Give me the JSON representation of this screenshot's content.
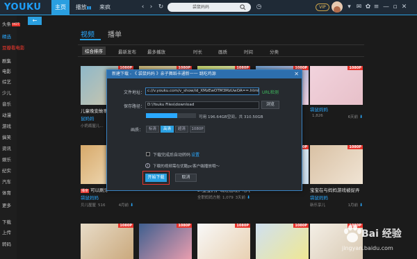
{
  "app": {
    "logo": "YOUKU"
  },
  "nav": [
    {
      "label": "主页",
      "active": true
    },
    {
      "label": "播放"
    },
    {
      "label": "来疯"
    }
  ],
  "search": {
    "value": "袋鼠妈妈"
  },
  "user": {
    "vip_label": "VIP"
  },
  "sidebar": {
    "items": [
      {
        "label": "头条",
        "badge": "HOT"
      },
      {
        "label": "精选",
        "style": "hl"
      },
      {
        "label": "豆瓣看电影",
        "style": "red"
      },
      {
        "label": "剧集"
      },
      {
        "label": "电影"
      },
      {
        "label": "综艺"
      },
      {
        "label": "少儿"
      },
      {
        "label": "音乐"
      },
      {
        "label": "动漫"
      },
      {
        "label": "游戏"
      },
      {
        "label": "搞笑"
      },
      {
        "label": "资讯"
      },
      {
        "label": "娱乐"
      },
      {
        "label": "纪实"
      },
      {
        "label": "汽车"
      },
      {
        "label": "体育"
      },
      {
        "label": "更多"
      },
      {
        "label": "下载"
      },
      {
        "label": "上传"
      },
      {
        "label": "转码"
      }
    ]
  },
  "main": {
    "tabs": [
      {
        "label": "视频",
        "active": true
      },
      {
        "label": "播单"
      }
    ],
    "filters": [
      {
        "label": "综合排序",
        "active": true
      },
      {
        "label": "最新发布"
      },
      {
        "label": "最多播放"
      },
      {
        "label": "时长"
      },
      {
        "label": "画质"
      },
      {
        "label": "时间"
      },
      {
        "label": "分类"
      }
    ]
  },
  "cards": [
    {
      "badge": "1080P",
      "title": "儿童晚安故事",
      "tag": "鼠妈妈",
      "author": "小奶瓶屋儿...",
      "plays": "",
      "date": ""
    },
    {
      "badge": "1080P",
      "title": "",
      "tag": "",
      "author": "",
      "plays": "",
      "date": ""
    },
    {
      "badge": "1080P",
      "title": "",
      "tag": "",
      "author": "",
      "plays": "",
      "date": ""
    },
    {
      "badge": "1080P",
      "title": "",
      "tag": "",
      "author": "",
      "plays": "",
      "date": ""
    },
    {
      "badge": "1080P",
      "title": "",
      "tag": "袋鼠妈妈",
      "author": "",
      "plays": "1,826",
      "date": "6天前"
    },
    {
      "badge": "1080P",
      "title": "可以刷牙",
      "tag": "袋鼠妈妈",
      "author": "贝儿屋屋",
      "plays": "516",
      "date": "4月前",
      "prefix": "播亲"
    },
    {
      "badge": "1080P",
      "title": "",
      "tag": "",
      "author": "亲子游戏",
      "plays": "",
      "date": ""
    },
    {
      "badge": "1080P",
      "title": "2:宝宝们，萌娃出境，哈哈大...",
      "tag": "",
      "author": "全职妈妈方舱",
      "plays": "1,079",
      "date": "3天前"
    },
    {
      "badge": "1080P",
      "title": "",
      "tag": "",
      "author": "",
      "plays": "",
      "date": ""
    },
    {
      "badge": "1080P",
      "title": "宝宝在与妈妈游戏被捉弄",
      "tag": "袋鼠妈妈",
      "author": "新乐享儿",
      "plays": "",
      "date": "1月前"
    },
    {
      "badge": "1080P"
    },
    {
      "badge": "1080P"
    },
    {
      "badge": "1080P"
    },
    {
      "badge": "1080P"
    },
    {
      "badge": "1080P"
    }
  ],
  "dialog": {
    "title": "新建下载 - 《 袋鼠妈妈 》亲子舞蹈卡通新一一 跳吃鸡源",
    "url_label": "文件地址：",
    "url_value": "c://v.youku.com/v_show/id_XMzEwOTM3MzUwOA==.html",
    "url_hint": "URL检测",
    "path_label": "保存路径：",
    "path_value": "D:\\Youku Files\\download",
    "browse_label": "浏览",
    "space_text": "可用 196.64GB空间，共 310.50GB",
    "space_fraction": 0.63,
    "quality_label": "画质：",
    "quality_options": [
      "标清",
      "高清",
      "超清",
      "1080P"
    ],
    "quality_selected": 1,
    "transcode_label": "下载完成后自动转码",
    "transcode_settings": "设置",
    "note": "下载的视频需在优酷pc客户端播放哦～",
    "start_label": "开始下载",
    "cancel_label": "取消"
  },
  "watermark": {
    "text": "Bai 经验",
    "url": "jingyan.baidu.com"
  }
}
